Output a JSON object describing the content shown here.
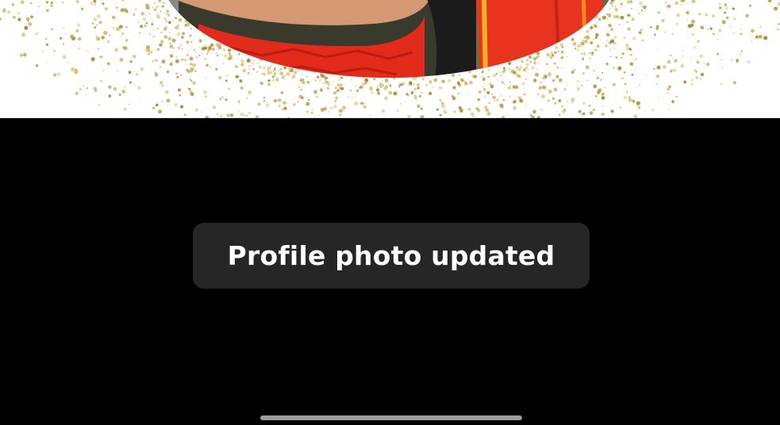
{
  "toast": {
    "message": "Profile photo updated"
  },
  "profile_photo": {
    "icon": "profile-photo-with-glitter-frame"
  },
  "colors": {
    "background": "#000000",
    "toast_background": "#262626",
    "toast_text": "#ffffff",
    "home_indicator": "#9c9c9c",
    "glitter": "#c9a54a"
  }
}
